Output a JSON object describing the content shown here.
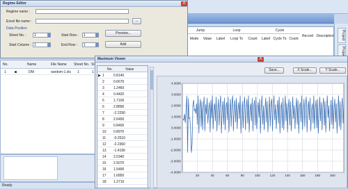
{
  "background_app": {
    "column_groups": [
      "Jump",
      "Loop",
      "Cycle"
    ],
    "columns": [
      "Mode",
      "Value",
      "Label",
      "Loop To",
      "Count",
      "Label",
      "Cycle To",
      "Count",
      "Record",
      "Description"
    ],
    "dock_tabs": [
      "Project",
      "Proper"
    ],
    "left_table_headers": [
      "No.",
      "Name",
      "File Name",
      "Sheet No.",
      "Start"
    ],
    "left_table_row": {
      "no": "1",
      "name": "DM",
      "file": "random-1.xls",
      "sheet": "1",
      "start": "1"
    },
    "status": "Ready"
  },
  "regime_editor": {
    "title": "Regime Editor",
    "regime_name_label": "Regime name :",
    "regime_name_value": "",
    "excel_file_label": "Excel file name :",
    "excel_file_value": "",
    "browse_label": "...",
    "data_position_label": "Data Position",
    "sheet_no_label": "Sheet No. :",
    "sheet_no_value": "1",
    "start_row_label": "Start Row :",
    "start_row_value": "1",
    "start_column_label": "Start Column :",
    "start_column_value": "1",
    "end_row_label": "End Row :",
    "end_row_value": "1",
    "preview_label": "Preview...",
    "add_label": "Add",
    "close": "X"
  },
  "viewer": {
    "title": "Maximum Viewer",
    "close": "X",
    "list_headers": {
      "no": "No.",
      "value": "Value"
    },
    "rows": [
      {
        "no": "1",
        "value": "0.8140"
      },
      {
        "no": "2",
        "value": "0.6670"
      },
      {
        "no": "3",
        "value": "1.2460"
      },
      {
        "no": "4",
        "value": "0.4420"
      },
      {
        "no": "5",
        "value": "1.7100"
      },
      {
        "no": "6",
        "value": "2.8890"
      },
      {
        "no": "7",
        "value": "-2.2290"
      },
      {
        "no": "8",
        "value": "2.6450"
      },
      {
        "no": "9",
        "value": "0.8400"
      },
      {
        "no": "10",
        "value": "0.8970"
      },
      {
        "no": "11",
        "value": "-0.2510"
      },
      {
        "no": "12",
        "value": "-2.2360"
      },
      {
        "no": "13",
        "value": "-1.4190"
      },
      {
        "no": "14",
        "value": "2.0340"
      },
      {
        "no": "15",
        "value": "2.5070"
      },
      {
        "no": "16",
        "value": "1.5490"
      },
      {
        "no": "17",
        "value": "1.6850"
      },
      {
        "no": "18",
        "value": "1.2710"
      }
    ],
    "selected_marker": "▶",
    "save_label": "Save...",
    "x_scale_label": "X Scale...",
    "y_scale_label": "Y Scale..."
  },
  "chart_data": {
    "type": "line",
    "title": "",
    "xlabel": "",
    "ylabel": "",
    "xlim": [
      0,
      215
    ],
    "ylim": [
      -4,
      4
    ],
    "x_ticks": [
      20,
      40,
      60,
      80,
      100,
      120,
      140,
      160,
      180,
      200
    ],
    "y_ticks": [
      "4.0000",
      "3.0000",
      "2.0000",
      "1.0000",
      "0.0000",
      "-1.0000",
      "-2.0000",
      "-3.0000",
      "-4.0000"
    ],
    "grid": true,
    "series_color": "#3f73b7",
    "series": [
      {
        "values": [
          0.814,
          0.667,
          1.246,
          0.442,
          1.71,
          2.889,
          -2.229,
          2.645,
          0.84,
          0.897,
          -0.251,
          -2.236,
          -1.419,
          2.034,
          2.507,
          1.549,
          1.685,
          1.271,
          2.2,
          0.3,
          2.9,
          -0.5,
          1.8,
          2.6,
          0.1,
          2.4,
          -0.2,
          1.9,
          2.8,
          -0.3,
          2.1,
          1.2,
          2.7,
          0.4,
          1.6,
          2.3,
          -0.4,
          2.5,
          0.9,
          2.9,
          -0.1,
          1.7,
          2.2,
          0.6,
          2.8,
          -0.3,
          1.4,
          2.6,
          0.2,
          2.0,
          2.9,
          -0.5,
          1.5,
          2.4,
          0.3,
          2.7,
          -0.2,
          1.9,
          2.3,
          0.7,
          2.8,
          -0.4,
          1.3,
          2.6,
          0.1,
          2.2,
          2.9,
          -0.3,
          1.8,
          2.5,
          0.5,
          2.7,
          -0.1,
          1.6,
          2.3,
          0.8,
          2.9,
          -0.5,
          1.2,
          2.4,
          0.0,
          2.1,
          2.8,
          -0.2,
          1.7,
          2.6,
          0.4,
          2.9,
          -0.4,
          1.5,
          2.2,
          0.6,
          2.7,
          -0.3,
          1.9,
          2.5,
          0.2,
          2.8,
          -0.1,
          1.4,
          2.3,
          0.9,
          2.6,
          -0.5,
          1.8,
          2.9,
          0.3,
          2.0,
          -0.2,
          1.6,
          2.7,
          0.5,
          2.4,
          -0.4,
          1.3,
          2.8,
          0.1,
          2.2,
          2.6,
          -0.3,
          1.9,
          2.9,
          0.7,
          2.1,
          -0.1,
          1.5,
          2.5,
          0.4,
          2.8,
          -0.5,
          1.7,
          2.3,
          0.0,
          2.7,
          -0.2,
          1.4,
          2.9,
          0.6,
          2.2,
          -0.4,
          1.8,
          2.6,
          0.2,
          2.4,
          -0.3,
          1.2,
          2.8,
          0.8,
          2.0,
          -0.1,
          1.6,
          2.7,
          0.3,
          2.5,
          -0.5,
          1.9,
          2.3,
          0.5,
          2.9,
          -0.2,
          1.3,
          2.6,
          0.1,
          2.1,
          2.8,
          -0.4,
          1.7,
          2.4,
          0.7,
          2.7,
          -0.3,
          1.5,
          2.2,
          0.4,
          2.9,
          -0.1,
          1.8,
          2.5,
          0.0,
          2.6,
          -0.5,
          1.4,
          2.8,
          0.6,
          2.3,
          -0.2,
          1.9,
          2.7,
          0.2,
          2.4,
          -0.4,
          1.6,
          2.9,
          0.9,
          2.0,
          -0.3,
          1.2,
          2.5,
          0.3,
          2.8,
          -0.1,
          1.7,
          2.6,
          0.5,
          2.2,
          -0.5,
          1.5,
          2.9,
          0.1,
          2.4,
          -0.2,
          1.8,
          2.7,
          0.4,
          2.1
        ]
      }
    ]
  }
}
